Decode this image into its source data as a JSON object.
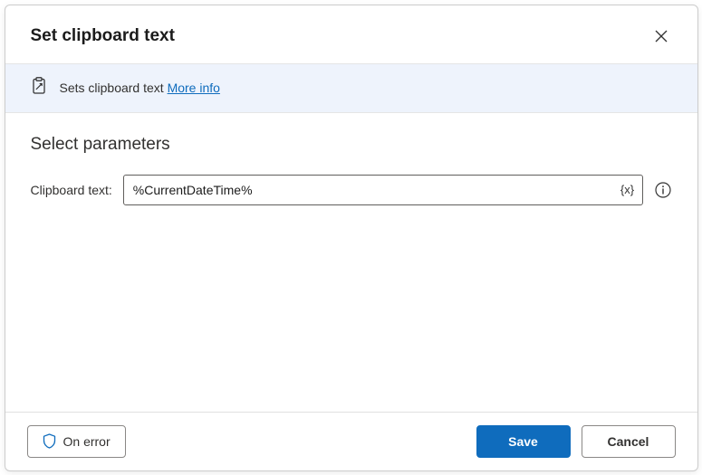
{
  "header": {
    "title": "Set clipboard text"
  },
  "banner": {
    "description": "Sets clipboard text",
    "more_info_label": "More info"
  },
  "section": {
    "heading": "Select parameters"
  },
  "fields": {
    "clipboard_text": {
      "label": "Clipboard text:",
      "value": "%CurrentDateTime%",
      "var_label": "{x}"
    }
  },
  "footer": {
    "on_error_label": "On error",
    "save_label": "Save",
    "cancel_label": "Cancel"
  }
}
